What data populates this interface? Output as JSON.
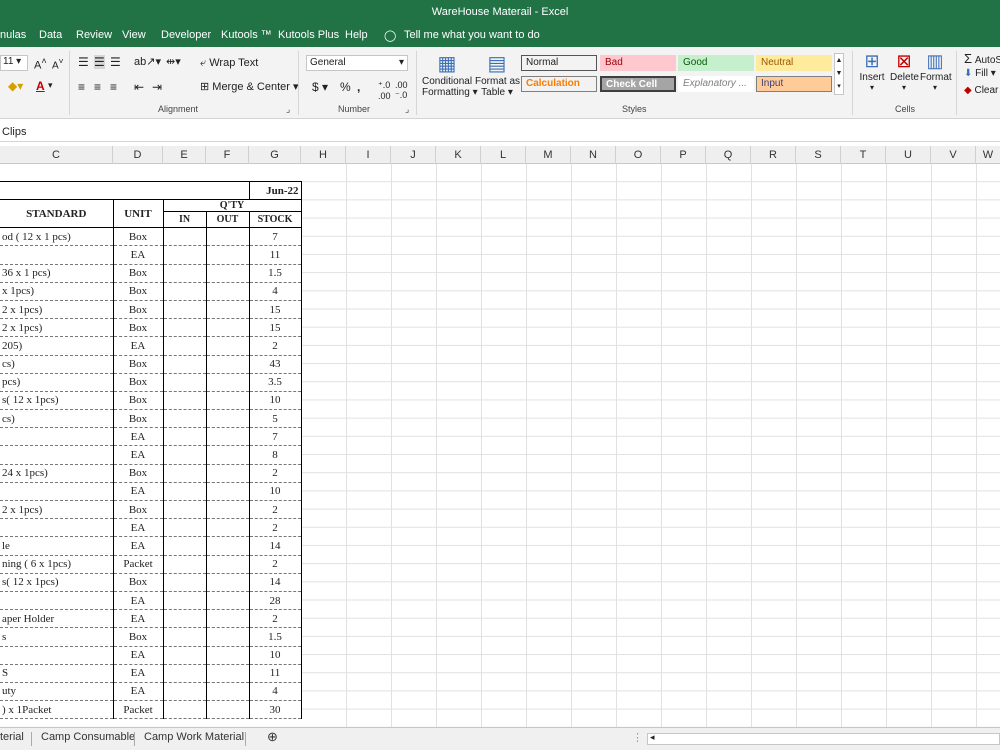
{
  "window": {
    "title": "WareHouse Materail  -  Excel"
  },
  "menu": [
    "nulas",
    "Data",
    "Review",
    "View",
    "Developer",
    "Kutools ™",
    "Kutools Plus",
    "Help"
  ],
  "tell_me": "Tell me what you want to do",
  "ribbon": {
    "font_size": "11",
    "wrap_text": "Wrap Text",
    "merge_center": "Merge & Center",
    "alignment_label": "Alignment",
    "number_format": "General",
    "number_label": "Number",
    "cond_format": [
      "Conditional",
      "Formatting"
    ],
    "format_table": [
      "Format as",
      "Table"
    ],
    "styles_label": "Styles",
    "styles": [
      {
        "label": "Normal",
        "bg": "#ffffff",
        "fg": "#000000"
      },
      {
        "label": "Bad",
        "bg": "#ffc7ce",
        "fg": "#9c0006"
      },
      {
        "label": "Good",
        "bg": "#c6efce",
        "fg": "#006100"
      },
      {
        "label": "Neutral",
        "bg": "#ffeb9c",
        "fg": "#9c5700"
      },
      {
        "label": "Calculation",
        "bg": "#f2f2f2",
        "fg": "#fa7d00"
      },
      {
        "label": "Check Cell",
        "bg": "#a5a5a5",
        "fg": "#ffffff"
      },
      {
        "label": "Explanatory ...",
        "bg": "#ffffff",
        "fg": "#7f7f7f"
      },
      {
        "label": "Input",
        "bg": "#ffcc99",
        "fg": "#3f3f76"
      }
    ],
    "cells_buttons": [
      "Insert",
      "Delete",
      "Format"
    ],
    "cells_label": "Cells",
    "editing": [
      "AutoS",
      "Fill",
      "Clear"
    ]
  },
  "formula_bar": {
    "content": "Clips"
  },
  "columns": [
    "C",
    "D",
    "E",
    "F",
    "G",
    "H",
    "I",
    "J",
    "K",
    "L",
    "M",
    "N",
    "O",
    "P",
    "Q",
    "R",
    "S",
    "T",
    "U",
    "V",
    "W"
  ],
  "table": {
    "date": "Jun-22",
    "headers": {
      "standard": "STANDARD",
      "unit": "UNIT",
      "qty": "Q'TY",
      "in": "IN",
      "out": "OUT",
      "stock": "STOCK"
    },
    "rows": [
      {
        "standard": "od ( 12 x 1 pcs)",
        "unit": "Box",
        "stock": "7"
      },
      {
        "standard": "",
        "unit": "EA",
        "stock": "11"
      },
      {
        "standard": " 36 x 1 pcs)",
        "unit": "Box",
        "stock": "1.5"
      },
      {
        "standard": " x 1pcs)",
        "unit": "Box",
        "stock": "4"
      },
      {
        "standard": "2 x 1pcs)",
        "unit": "Box",
        "stock": "15"
      },
      {
        "standard": "2 x 1pcs)",
        "unit": "Box",
        "stock": "15"
      },
      {
        "standard": "205)",
        "unit": "EA",
        "stock": "2"
      },
      {
        "standard": "cs)",
        "unit": "Box",
        "stock": "43"
      },
      {
        "standard": "pcs)",
        "unit": "Box",
        "stock": "3.5"
      },
      {
        "standard": "s( 12 x 1pcs)",
        "unit": "Box",
        "stock": "10"
      },
      {
        "standard": "cs)",
        "unit": "Box",
        "stock": "5"
      },
      {
        "standard": "",
        "unit": "EA",
        "stock": "7"
      },
      {
        "standard": "",
        "unit": "EA",
        "stock": "8"
      },
      {
        "standard": " 24 x 1pcs)",
        "unit": "Box",
        "stock": "2"
      },
      {
        "standard": "",
        "unit": "EA",
        "stock": "10"
      },
      {
        "standard": "2 x 1pcs)",
        "unit": "Box",
        "stock": "2"
      },
      {
        "standard": "",
        "unit": "EA",
        "stock": "2"
      },
      {
        "standard": "le",
        "unit": "EA",
        "stock": "14"
      },
      {
        "standard": "ning ( 6 x 1pcs)",
        "unit": "Packet",
        "stock": "2"
      },
      {
        "standard": "s( 12 x 1pcs)",
        "unit": "Box",
        "stock": "14"
      },
      {
        "standard": "",
        "unit": "EA",
        "stock": "28"
      },
      {
        "standard": "aper Holder",
        "unit": "EA",
        "stock": "2"
      },
      {
        "standard": "s",
        "unit": "Box",
        "stock": "1.5"
      },
      {
        "standard": "",
        "unit": "EA",
        "stock": "10"
      },
      {
        "standard": "S",
        "unit": "EA",
        "stock": "11"
      },
      {
        "standard": "uty",
        "unit": "EA",
        "stock": "4"
      },
      {
        "standard": ") x 1Packet",
        "unit": "Packet",
        "stock": "30"
      }
    ]
  },
  "sheets": [
    "terial",
    "Camp Consumable",
    "Camp Work Material"
  ],
  "add_sheet": "⊕"
}
